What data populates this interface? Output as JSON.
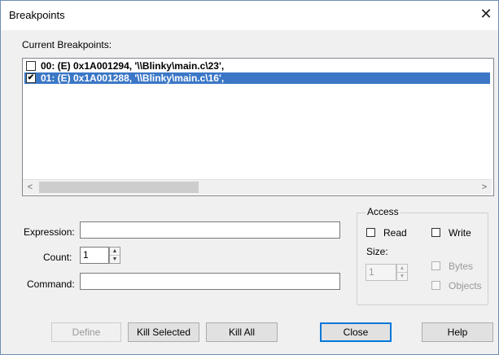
{
  "window": {
    "title": "Breakpoints"
  },
  "current_breakpoints": {
    "label": "Current Breakpoints:",
    "items": [
      {
        "text": "00: (E) 0x1A001294,  '\\\\Blinky\\main.c\\23',",
        "checked": false,
        "selected": false
      },
      {
        "text": "01: (E) 0x1A001288,  '\\\\Blinky\\main.c\\16',",
        "checked": true,
        "selected": true
      }
    ],
    "scroll_left": "<",
    "scroll_right": ">"
  },
  "form": {
    "expression_label": "Expression:",
    "expression_value": "",
    "count_label": "Count:",
    "count_value": "1",
    "command_label": "Command:",
    "command_value": ""
  },
  "access": {
    "title": "Access",
    "read_label": "Read",
    "write_label": "Write",
    "size_label": "Size:",
    "size_value": "1",
    "bytes_label": "Bytes",
    "objects_label": "Objects"
  },
  "buttons": {
    "define": "Define",
    "kill_selected": "Kill Selected",
    "kill_all": "Kill All",
    "close": "Close",
    "help": "Help"
  }
}
